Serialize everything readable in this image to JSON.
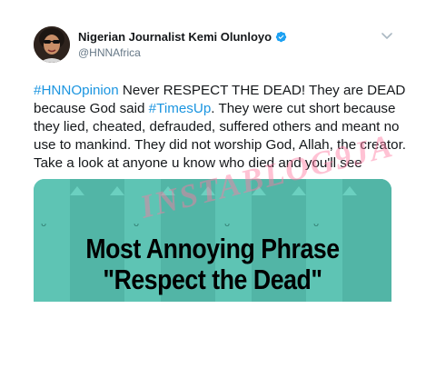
{
  "tweet": {
    "author_name": "Nigerian Journalist Kemi Olunloyo",
    "author_handle": "@HNNAfrica",
    "verified_icon": "verified-badge-icon",
    "menu_icon": "chevron-down-icon",
    "text_lines": [
      [
        {
          "type": "hashtag",
          "text": "#HNNOpinion"
        },
        {
          "type": "text",
          "text": " Never RESPECT THE DEAD! They are DEAD"
        }
      ],
      [
        {
          "type": "text",
          "text": "because God said "
        },
        {
          "type": "hashtag",
          "text": "#TimesUp"
        },
        {
          "type": "text",
          "text": ". They were cut short because"
        }
      ],
      [
        {
          "type": "text",
          "text": "they lied, cheated, defrauded, suffered others and meant no"
        }
      ],
      [
        {
          "type": "text",
          "text": "use to mankind. They did not worship God, Allah, the creator."
        }
      ],
      [
        {
          "type": "text",
          "text": "Take a look at anyone u know who died and you'll see"
        }
      ]
    ],
    "media": {
      "line1": "Most Annoying Phrase",
      "line2": "\"Respect the Dead\"",
      "background_color": "#5ec4b4"
    }
  },
  "watermark": {
    "text": "INSTABLOG9JA"
  },
  "colors": {
    "name": "#14171a",
    "handle": "#657786",
    "hashtag": "#1b95e0",
    "verified": "#1da1f2"
  }
}
